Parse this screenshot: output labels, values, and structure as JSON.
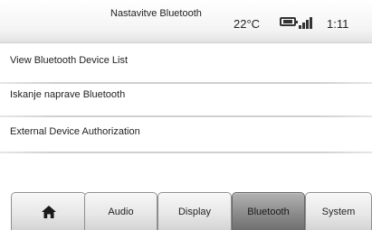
{
  "header": {
    "title": "Nastavitve Bluetooth",
    "temperature": "22°C",
    "time": "1:11"
  },
  "menu": {
    "items": [
      {
        "label": "View Bluetooth Device List"
      },
      {
        "label": "Iskanje naprave Bluetooth"
      },
      {
        "label": "External Device Authorization"
      }
    ]
  },
  "tabs": {
    "home_icon": "home-icon",
    "items": [
      {
        "label": "Audio"
      },
      {
        "label": "Display"
      },
      {
        "label": "Bluetooth"
      },
      {
        "label": "System"
      }
    ],
    "active": "Bluetooth"
  },
  "colors": {
    "active_tab": "#8c8c8c",
    "tab": "#e8e8e8"
  }
}
